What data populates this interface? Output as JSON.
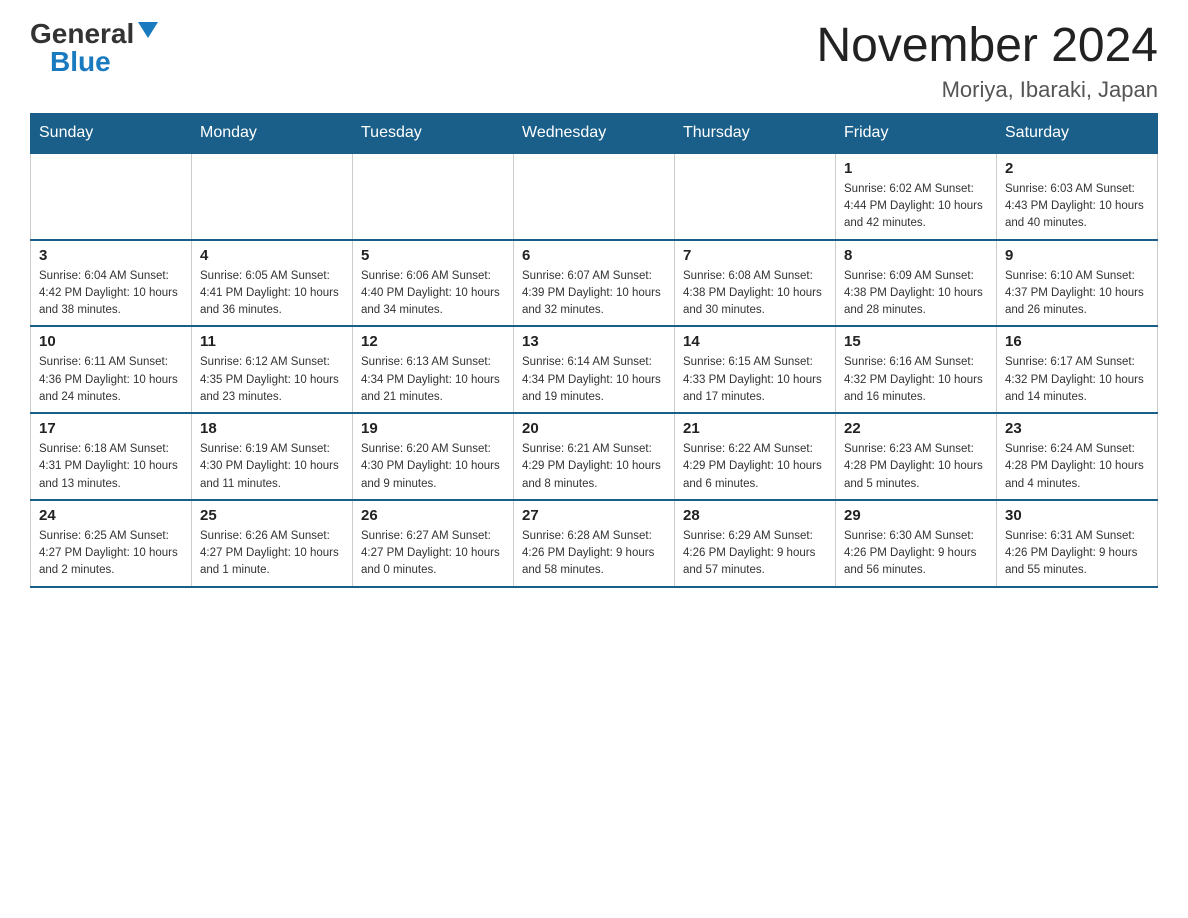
{
  "header": {
    "logo_general": "General",
    "logo_blue": "Blue",
    "month_title": "November 2024",
    "location": "Moriya, Ibaraki, Japan"
  },
  "days_of_week": [
    "Sunday",
    "Monday",
    "Tuesday",
    "Wednesday",
    "Thursday",
    "Friday",
    "Saturday"
  ],
  "weeks": [
    [
      {
        "day": "",
        "info": ""
      },
      {
        "day": "",
        "info": ""
      },
      {
        "day": "",
        "info": ""
      },
      {
        "day": "",
        "info": ""
      },
      {
        "day": "",
        "info": ""
      },
      {
        "day": "1",
        "info": "Sunrise: 6:02 AM\nSunset: 4:44 PM\nDaylight: 10 hours and 42 minutes."
      },
      {
        "day": "2",
        "info": "Sunrise: 6:03 AM\nSunset: 4:43 PM\nDaylight: 10 hours and 40 minutes."
      }
    ],
    [
      {
        "day": "3",
        "info": "Sunrise: 6:04 AM\nSunset: 4:42 PM\nDaylight: 10 hours and 38 minutes."
      },
      {
        "day": "4",
        "info": "Sunrise: 6:05 AM\nSunset: 4:41 PM\nDaylight: 10 hours and 36 minutes."
      },
      {
        "day": "5",
        "info": "Sunrise: 6:06 AM\nSunset: 4:40 PM\nDaylight: 10 hours and 34 minutes."
      },
      {
        "day": "6",
        "info": "Sunrise: 6:07 AM\nSunset: 4:39 PM\nDaylight: 10 hours and 32 minutes."
      },
      {
        "day": "7",
        "info": "Sunrise: 6:08 AM\nSunset: 4:38 PM\nDaylight: 10 hours and 30 minutes."
      },
      {
        "day": "8",
        "info": "Sunrise: 6:09 AM\nSunset: 4:38 PM\nDaylight: 10 hours and 28 minutes."
      },
      {
        "day": "9",
        "info": "Sunrise: 6:10 AM\nSunset: 4:37 PM\nDaylight: 10 hours and 26 minutes."
      }
    ],
    [
      {
        "day": "10",
        "info": "Sunrise: 6:11 AM\nSunset: 4:36 PM\nDaylight: 10 hours and 24 minutes."
      },
      {
        "day": "11",
        "info": "Sunrise: 6:12 AM\nSunset: 4:35 PM\nDaylight: 10 hours and 23 minutes."
      },
      {
        "day": "12",
        "info": "Sunrise: 6:13 AM\nSunset: 4:34 PM\nDaylight: 10 hours and 21 minutes."
      },
      {
        "day": "13",
        "info": "Sunrise: 6:14 AM\nSunset: 4:34 PM\nDaylight: 10 hours and 19 minutes."
      },
      {
        "day": "14",
        "info": "Sunrise: 6:15 AM\nSunset: 4:33 PM\nDaylight: 10 hours and 17 minutes."
      },
      {
        "day": "15",
        "info": "Sunrise: 6:16 AM\nSunset: 4:32 PM\nDaylight: 10 hours and 16 minutes."
      },
      {
        "day": "16",
        "info": "Sunrise: 6:17 AM\nSunset: 4:32 PM\nDaylight: 10 hours and 14 minutes."
      }
    ],
    [
      {
        "day": "17",
        "info": "Sunrise: 6:18 AM\nSunset: 4:31 PM\nDaylight: 10 hours and 13 minutes."
      },
      {
        "day": "18",
        "info": "Sunrise: 6:19 AM\nSunset: 4:30 PM\nDaylight: 10 hours and 11 minutes."
      },
      {
        "day": "19",
        "info": "Sunrise: 6:20 AM\nSunset: 4:30 PM\nDaylight: 10 hours and 9 minutes."
      },
      {
        "day": "20",
        "info": "Sunrise: 6:21 AM\nSunset: 4:29 PM\nDaylight: 10 hours and 8 minutes."
      },
      {
        "day": "21",
        "info": "Sunrise: 6:22 AM\nSunset: 4:29 PM\nDaylight: 10 hours and 6 minutes."
      },
      {
        "day": "22",
        "info": "Sunrise: 6:23 AM\nSunset: 4:28 PM\nDaylight: 10 hours and 5 minutes."
      },
      {
        "day": "23",
        "info": "Sunrise: 6:24 AM\nSunset: 4:28 PM\nDaylight: 10 hours and 4 minutes."
      }
    ],
    [
      {
        "day": "24",
        "info": "Sunrise: 6:25 AM\nSunset: 4:27 PM\nDaylight: 10 hours and 2 minutes."
      },
      {
        "day": "25",
        "info": "Sunrise: 6:26 AM\nSunset: 4:27 PM\nDaylight: 10 hours and 1 minute."
      },
      {
        "day": "26",
        "info": "Sunrise: 6:27 AM\nSunset: 4:27 PM\nDaylight: 10 hours and 0 minutes."
      },
      {
        "day": "27",
        "info": "Sunrise: 6:28 AM\nSunset: 4:26 PM\nDaylight: 9 hours and 58 minutes."
      },
      {
        "day": "28",
        "info": "Sunrise: 6:29 AM\nSunset: 4:26 PM\nDaylight: 9 hours and 57 minutes."
      },
      {
        "day": "29",
        "info": "Sunrise: 6:30 AM\nSunset: 4:26 PM\nDaylight: 9 hours and 56 minutes."
      },
      {
        "day": "30",
        "info": "Sunrise: 6:31 AM\nSunset: 4:26 PM\nDaylight: 9 hours and 55 minutes."
      }
    ]
  ]
}
